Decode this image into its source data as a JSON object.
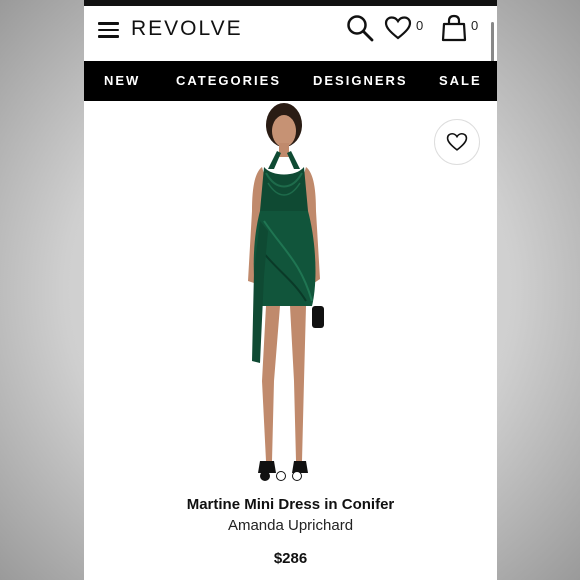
{
  "header": {
    "logo": "REVOLVE",
    "wishlist_count": "0",
    "bag_count": "0"
  },
  "nav": {
    "items": [
      "NEW",
      "CATEGORIES",
      "DESIGNERS",
      "SALE"
    ]
  },
  "product": {
    "name": "Martine Mini Dress in Conifer",
    "brand": "Amanda Uprichard",
    "price": "$286",
    "image_count": 3,
    "active_image": 1,
    "dress_color": "#0f4a33"
  },
  "colors": {
    "header_bg": "#ffffff",
    "nav_bg": "#000000",
    "text": "#111111"
  }
}
